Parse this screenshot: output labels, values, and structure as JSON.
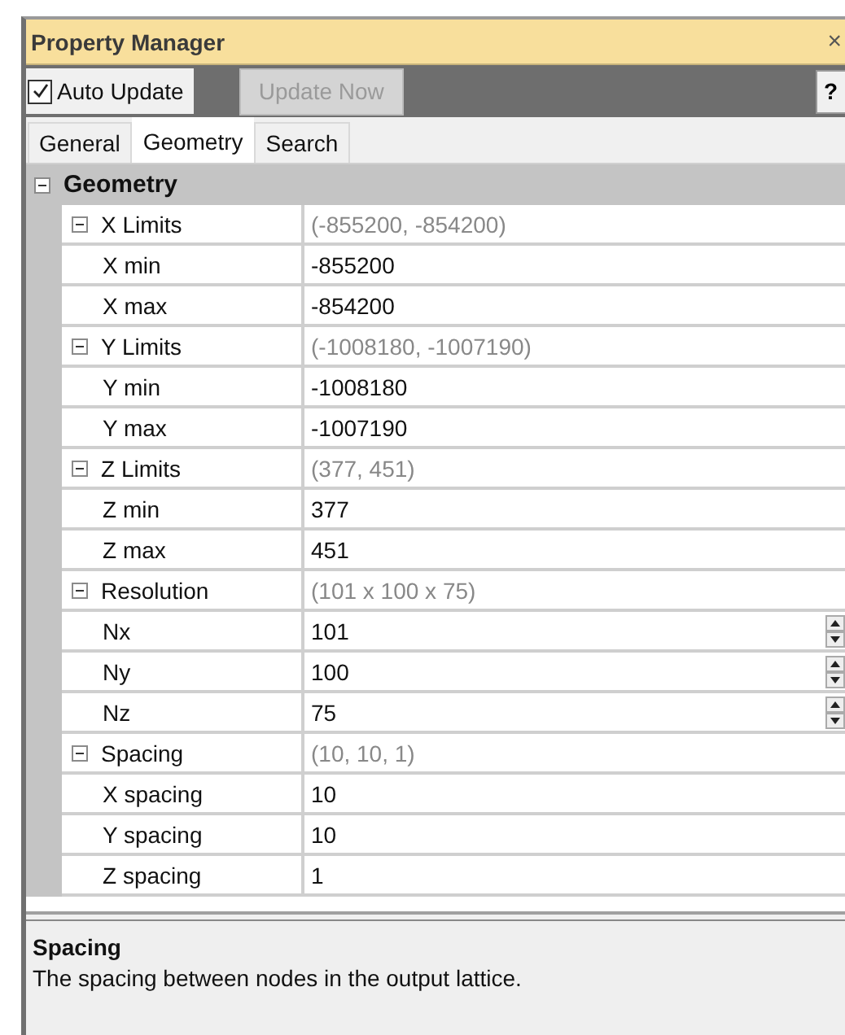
{
  "window": {
    "title": "Property Manager",
    "close_button": "×"
  },
  "toolbar": {
    "auto_update": {
      "label": "Auto Update",
      "checked": true
    },
    "update_now": {
      "label": "Update Now",
      "disabled": true
    },
    "help_button": "?"
  },
  "tabs": [
    {
      "label": "General",
      "selected": false
    },
    {
      "label": "Geometry",
      "selected": true
    },
    {
      "label": "Search",
      "selected": false
    }
  ],
  "grid": {
    "category": {
      "label": "Geometry",
      "expanded": true
    },
    "groups": [
      {
        "label": "X Limits",
        "summary": "(-855200, -854200)",
        "expanded": true,
        "children": [
          {
            "label": "X min",
            "value": "-855200",
            "kind": "text"
          },
          {
            "label": "X max",
            "value": "-854200",
            "kind": "text"
          }
        ]
      },
      {
        "label": "Y Limits",
        "summary": "(-1008180, -1007190)",
        "expanded": true,
        "children": [
          {
            "label": "Y min",
            "value": "-1008180",
            "kind": "text"
          },
          {
            "label": "Y max",
            "value": "-1007190",
            "kind": "text"
          }
        ]
      },
      {
        "label": "Z Limits",
        "summary": "(377, 451)",
        "expanded": true,
        "children": [
          {
            "label": "Z min",
            "value": "377",
            "kind": "text"
          },
          {
            "label": "Z max",
            "value": "451",
            "kind": "text"
          }
        ]
      },
      {
        "label": "Resolution",
        "summary": "(101 x 100 x 75)",
        "expanded": true,
        "children": [
          {
            "label": "Nx",
            "value": "101",
            "kind": "spinner"
          },
          {
            "label": "Ny",
            "value": "100",
            "kind": "spinner"
          },
          {
            "label": "Nz",
            "value": "75",
            "kind": "spinner"
          }
        ]
      },
      {
        "label": "Spacing",
        "summary": "(10, 10, 1)",
        "expanded": true,
        "children": [
          {
            "label": "X spacing",
            "value": "10",
            "kind": "text"
          },
          {
            "label": "Y spacing",
            "value": "10",
            "kind": "text"
          },
          {
            "label": "Z spacing",
            "value": "1",
            "kind": "text"
          }
        ]
      }
    ]
  },
  "description": {
    "title": "Spacing",
    "text": "The spacing between nodes in the output lattice."
  }
}
